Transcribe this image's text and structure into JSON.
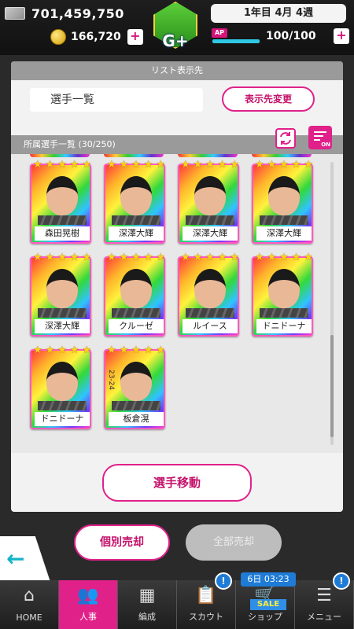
{
  "header": {
    "money": "701,459,750",
    "coins": "166,720",
    "rank": "G+",
    "date": "1年目 4月 4週",
    "ap_label": "AP",
    "ap_value": "100/100",
    "ap_fill": 1.0
  },
  "list_dest": {
    "section_title": "リスト表示先",
    "current": "選手一覧",
    "change_button": "表示先変更"
  },
  "players_section": {
    "title": "所属選手一覧 (30/250)",
    "filter_badge": "ON",
    "cards": [
      {
        "name": "森田晃樹",
        "stars": 5
      },
      {
        "name": "深澤大輝",
        "stars": 5
      },
      {
        "name": "深澤大輝",
        "stars": 5
      },
      {
        "name": "深澤大輝",
        "stars": 5
      },
      {
        "name": "深澤大輝",
        "stars": 5
      },
      {
        "name": "クルーゼ",
        "stars": 5
      },
      {
        "name": "ルイース",
        "stars": 5
      },
      {
        "name": "ドニドーナ",
        "stars": 5
      },
      {
        "name": "ドニドーナ",
        "stars": 5
      },
      {
        "name": "板倉滉",
        "stars": 5,
        "season": "23-24"
      }
    ],
    "move_button": "選手移動"
  },
  "actions": {
    "sell_single": "個別売却",
    "sell_all": "全部売却"
  },
  "nav": {
    "items": [
      {
        "label": "HOME",
        "icon": "home-icon"
      },
      {
        "label": "人事",
        "icon": "people-icon",
        "active": true
      },
      {
        "label": "編成",
        "icon": "pitch-icon"
      },
      {
        "label": "スカウト",
        "icon": "scout-icon",
        "badge": "!"
      },
      {
        "label": "ショップ",
        "icon": "shop-icon"
      },
      {
        "label": "メニュー",
        "icon": "menu-icon",
        "badge": "!"
      }
    ],
    "shop_timer": "6日 03:23",
    "sale_tag": "SALE"
  },
  "colors": {
    "accent": "#e0218a",
    "ap_bar": "#2fc9e6",
    "notify": "#1e7bd6"
  }
}
